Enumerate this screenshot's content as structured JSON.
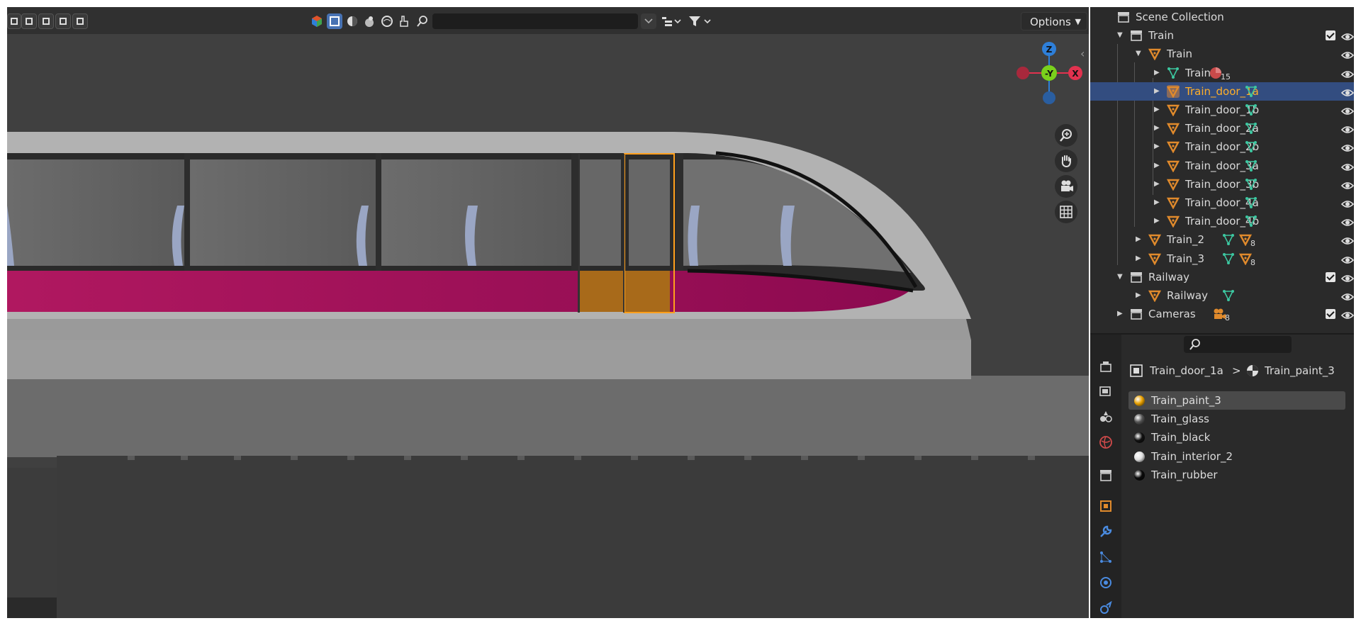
{
  "viewport": {
    "options_label": "Options",
    "axes": {
      "z": "Z",
      "y": "-Y",
      "x": "X"
    },
    "icons": [
      "select-mode-icons",
      "shading-solid-icon",
      "search-icon",
      "filter-icon",
      "zoom-icon",
      "hand-pan-icon",
      "camera-icon",
      "grid-icon"
    ]
  },
  "outliner": {
    "rows": [
      {
        "label": "Scene Collection",
        "type": "scene-collection"
      },
      {
        "label": "Train",
        "type": "collection",
        "checked": true
      },
      {
        "label": "Train",
        "type": "object"
      },
      {
        "label": "Train",
        "type": "mesh",
        "badge": "15"
      },
      {
        "label": "Train_door_1a",
        "type": "object",
        "selected": true
      },
      {
        "label": "Train_door_1b",
        "type": "object"
      },
      {
        "label": "Train_door_2a",
        "type": "object"
      },
      {
        "label": "Train_door_2b",
        "type": "object"
      },
      {
        "label": "Train_door_3a",
        "type": "object"
      },
      {
        "label": "Train_door_3b",
        "type": "object"
      },
      {
        "label": "Train_door_4a",
        "type": "object"
      },
      {
        "label": "Train_door_4b",
        "type": "object"
      },
      {
        "label": "Train_2",
        "type": "object",
        "badge": "8"
      },
      {
        "label": "Train_3",
        "type": "object",
        "badge": "8"
      },
      {
        "label": "Railway",
        "type": "collection",
        "checked": true
      },
      {
        "label": "Railway",
        "type": "object"
      },
      {
        "label": "Cameras",
        "type": "collection",
        "checked": true,
        "badge": "8"
      }
    ]
  },
  "properties": {
    "breadcrumb": {
      "object": "Train_door_1a",
      "separator": ">",
      "material": "Train_paint_3"
    },
    "materials": [
      {
        "name": "Train_paint_3",
        "color": "#e8a000",
        "active": true
      },
      {
        "name": "Train_glass",
        "color": "#555555"
      },
      {
        "name": "Train_black",
        "color": "#111111"
      },
      {
        "name": "Train_interior_2",
        "color": "#e0e0e0"
      },
      {
        "name": "Train_rubber",
        "color": "#0a0a0a"
      }
    ]
  },
  "colors": {
    "selection_orange": "#ffaf29",
    "train_magenta": "#b0185e",
    "selected_row": "#334d80",
    "axis_x": "#e2324f",
    "axis_y": "#7ad11c",
    "axis_z": "#2e7fd9"
  }
}
